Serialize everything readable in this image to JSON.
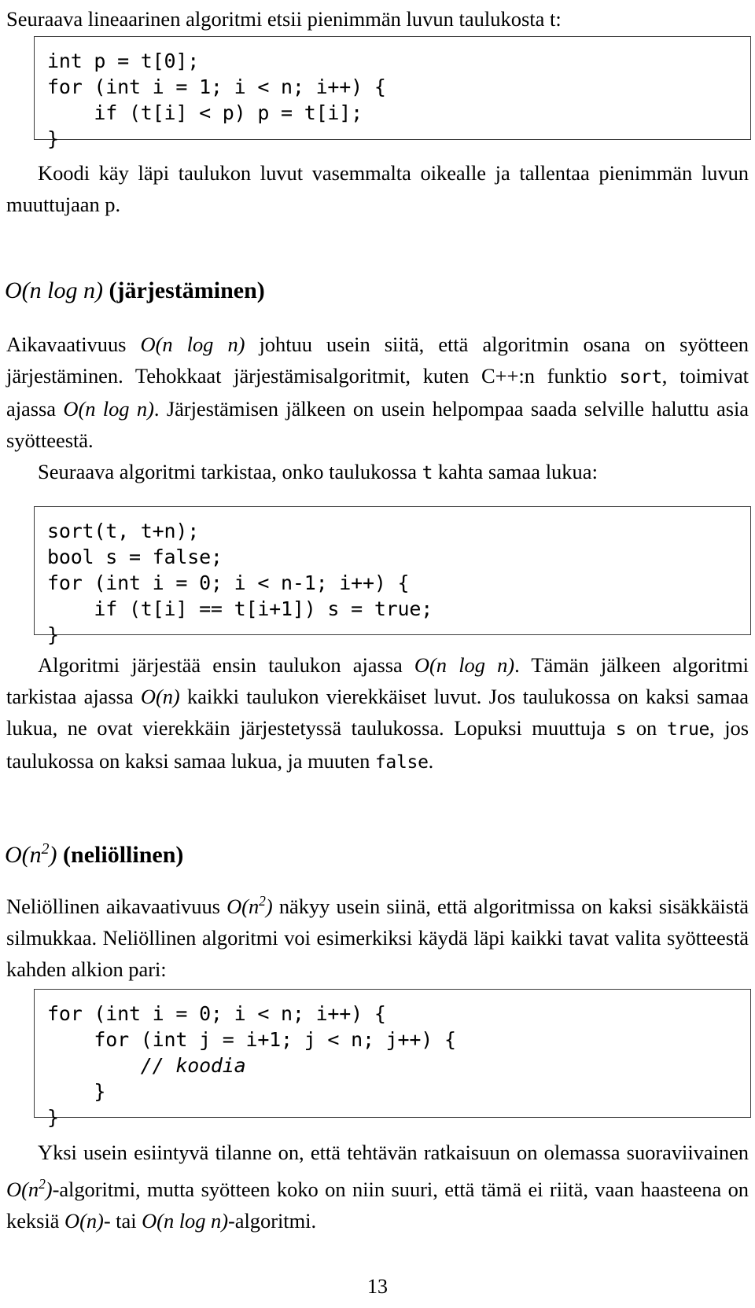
{
  "page": {
    "number": "13",
    "language": "fi"
  },
  "intro": {
    "text": "Seuraava lineaarinen algoritmi etsii pienimmän luvun taulukosta t:"
  },
  "code_block_1": {
    "lines": [
      "int p = t[0];",
      "for (int i = 1; i < n; i++) {",
      "    if (t[i] < p) p = t[i];",
      "}"
    ]
  },
  "para_1": {
    "text": "Koodi käy läpi taulukon luvut vasemmalta oikealle ja tallentaa pienimmän luvun muuttujaan p."
  },
  "section_nlogn": {
    "heading_math": "O(n log n)",
    "heading_bold": "(järjestäminen)",
    "para_parts": {
      "p1": "Aikavaativuus ",
      "m1": "O(n log n)",
      "p2": " johtuu usein siitä, että algoritmin osana on syötteen järjestäminen. Tehokkaat järjestämisalgoritmit, kuten C++:n funktio ",
      "c1": "sort",
      "p3": ", toimivat ajassa ",
      "m2": "O(n log n)",
      "p4": ". Järjestämisen jälkeen on usein helpompaa saada selville haluttu asia syötteestä."
    },
    "lead_in": {
      "p1": "Seuraava algoritmi tarkistaa, onko taulukossa ",
      "c1": "t",
      "p2": " kahta samaa lukua:"
    },
    "code_block_2": {
      "lines": [
        "sort(t, t+n);",
        "bool s = false;",
        "for (int i = 0; i < n-1; i++) {",
        "    if (t[i] == t[i+1]) s = true;",
        "}"
      ]
    },
    "para_after": {
      "p1": "Algoritmi järjestää ensin taulukon ajassa ",
      "m1": "O(n log n)",
      "p2": ". Tämän jälkeen algoritmi tarkistaa ajassa ",
      "m2": "O(n)",
      "p3": " kaikki taulukon vierekkäiset luvut. Jos taulukossa on kaksi samaa lukua, ne ovat vierekkäin järjestetyssä taulukossa. Lopuksi muuttuja ",
      "c1": "s",
      "p4": " on ",
      "c2": "true",
      "p5": ", jos taulukossa on kaksi samaa lukua, ja muuten ",
      "c3": "false",
      "p6": "."
    }
  },
  "section_n2": {
    "heading_math": "O(n²)",
    "heading_bold": "(neliöllinen)",
    "para_parts": {
      "p1": "Neliöllinen aikavaativuus ",
      "m1": "O(n²)",
      "p2": " näkyy usein siinä, että algoritmissa on kaksi sisäkkäistä silmukkaa. Neliöllinen algoritmi voi esimerkiksi käydä läpi kaikki tavat valita syötteestä kahden alkion pari:"
    },
    "code_block_3": {
      "lines": [
        "for (int i = 0; i < n; i++) {",
        "    for (int j = i+1; j < n; j++) {",
        "        // koodia",
        "    }",
        "}"
      ]
    },
    "para_after": {
      "p1": "Yksi usein esiintyvä tilanne on, että tehtävän ratkaisuun on olemassa suoraviivainen ",
      "m1": "O(n²)",
      "p2": "-algoritmi, mutta syötteen koko on niin suuri, että tämä ei riitä, vaan haasteena on keksiä ",
      "m2": "O(n)",
      "p3": "- tai ",
      "m3": "O(n log n)",
      "p4": "-algoritmi."
    }
  }
}
